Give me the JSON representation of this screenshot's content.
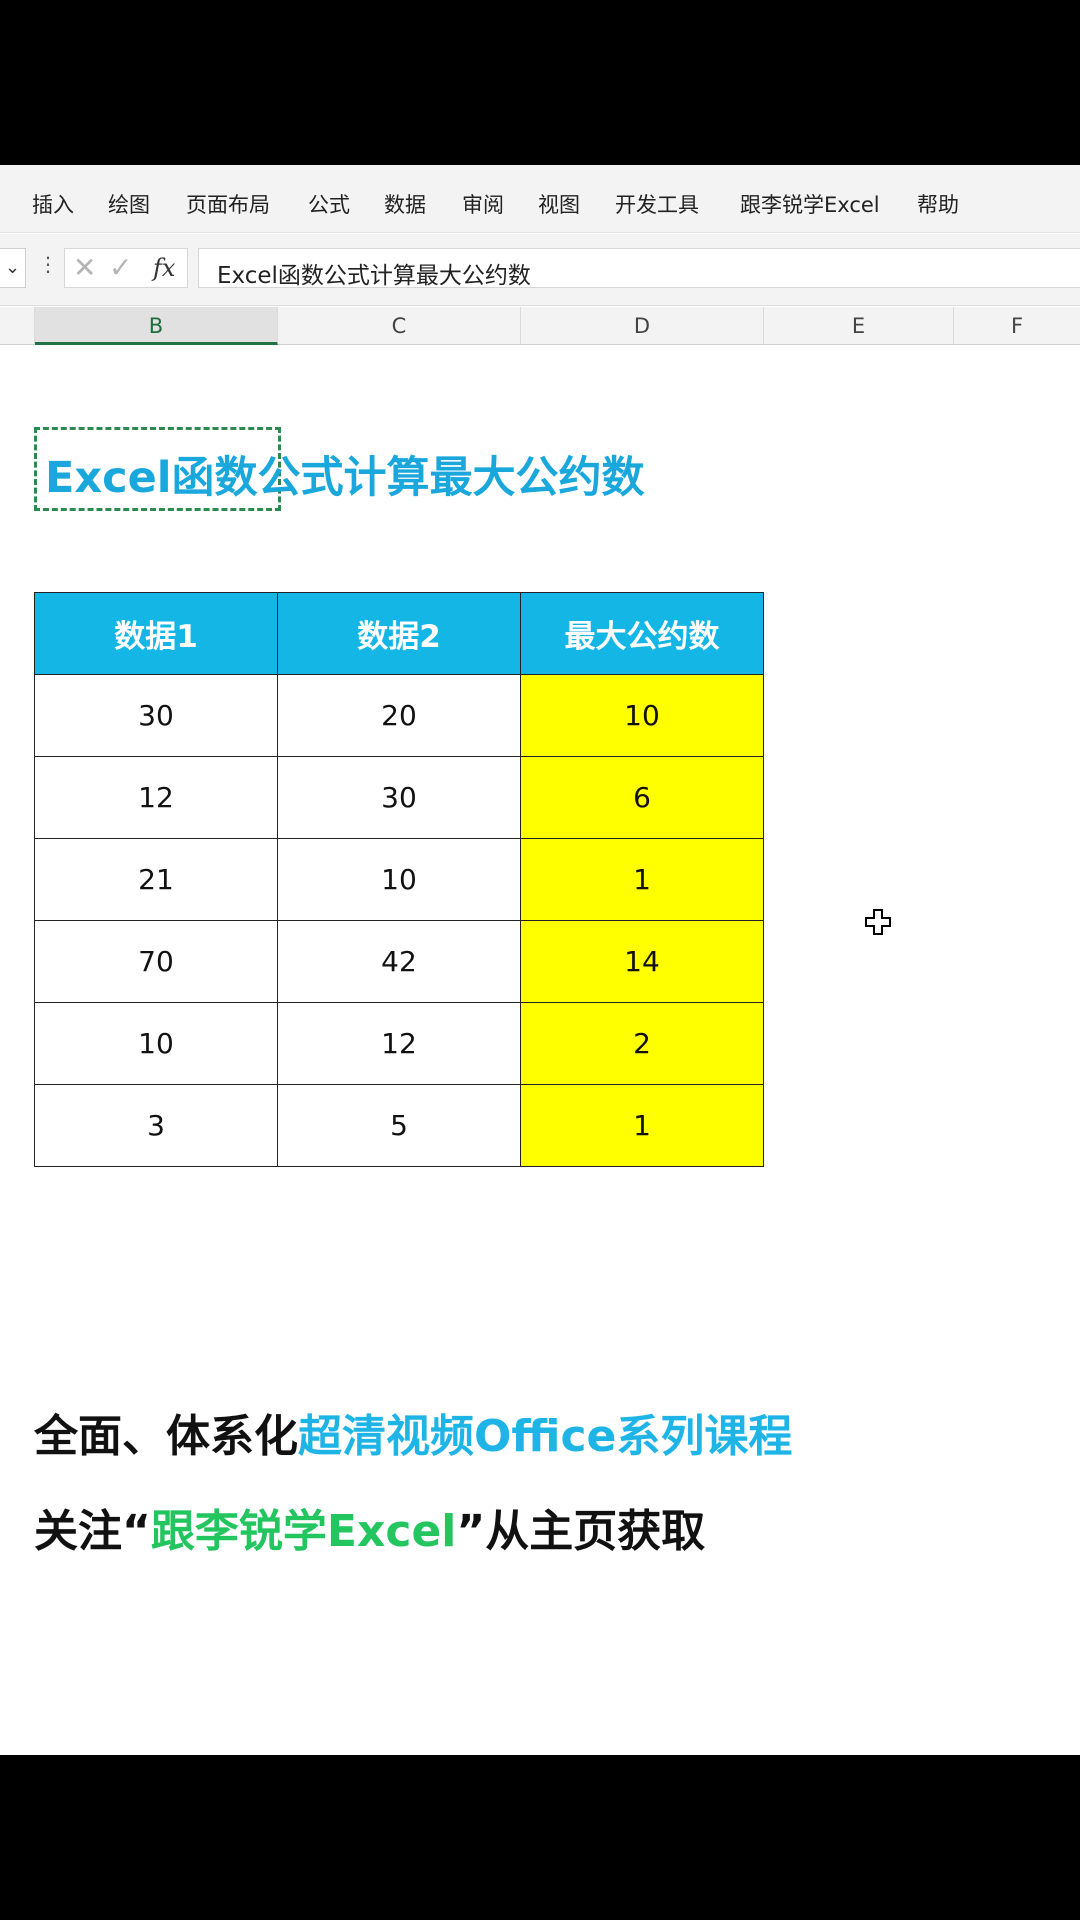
{
  "ribbon": {
    "tabs": [
      "插入",
      "绘图",
      "页面布局",
      "公式",
      "数据",
      "审阅",
      "视图",
      "开发工具",
      "跟李锐学Excel",
      "帮助"
    ]
  },
  "formula_bar": {
    "fx_label": "fx",
    "content": "Excel函数公式计算最大公约数"
  },
  "columns": [
    "B",
    "C",
    "D",
    "E",
    "F"
  ],
  "sheet": {
    "title": "Excel函数公式计算最大公约数",
    "table": {
      "headers": [
        "数据1",
        "数据2",
        "最大公约数"
      ],
      "rows": [
        [
          "30",
          "20",
          "10"
        ],
        [
          "12",
          "30",
          "6"
        ],
        [
          "21",
          "10",
          "1"
        ],
        [
          "70",
          "42",
          "14"
        ],
        [
          "10",
          "12",
          "2"
        ],
        [
          "3",
          "5",
          "1"
        ]
      ]
    }
  },
  "promo": {
    "line1_black": "全面、体系化",
    "line1_blue": "超清视频Office系列课程",
    "line2_a": "关注“",
    "line2_green": "跟李锐学Excel",
    "line2_b": "”从主页获取"
  },
  "colors": {
    "header_fill": "#13b6e4",
    "result_fill": "#ffff00",
    "title": "#1aa7dc",
    "accent_green": "#22c55e"
  }
}
